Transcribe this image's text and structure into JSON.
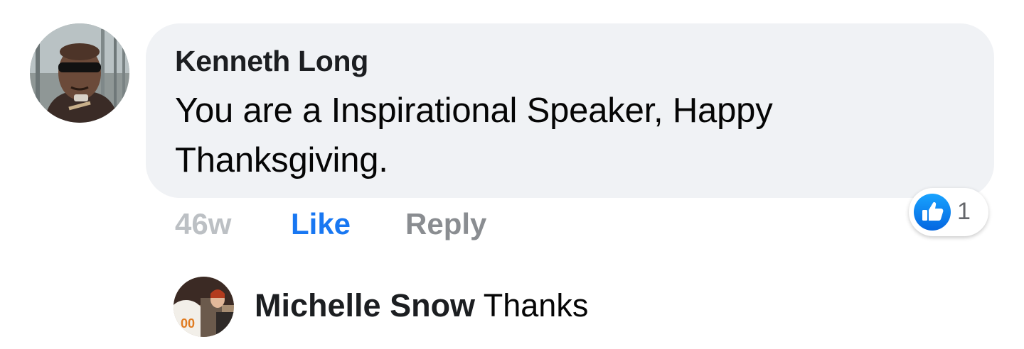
{
  "comment": {
    "author": "Kenneth Long",
    "text": "You are a Inspirational Speaker, Happy Thanksgiving.",
    "timestamp": "46w",
    "like_label": "Like",
    "reply_label": "Reply",
    "reaction": {
      "icon": "thumbs-up-icon",
      "count": "1",
      "color": "#1877f2"
    }
  },
  "reply": {
    "author": "Michelle Snow",
    "text": "Thanks"
  },
  "colors": {
    "bubble": "#f0f2f5",
    "link_blue": "#1877f2",
    "muted": "#8a8d91"
  }
}
